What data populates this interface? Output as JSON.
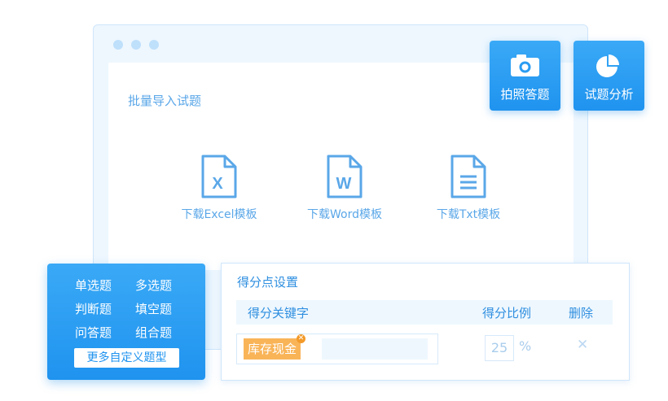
{
  "import_panel": {
    "title": "批量导入试题",
    "templates": [
      {
        "letter": "X",
        "label": "下载Excel模板"
      },
      {
        "letter": "W",
        "label": "下载Word模板"
      },
      {
        "letter": "",
        "label": "下载Txt模板"
      }
    ]
  },
  "actions": {
    "photo_answer": "拍照答题",
    "analysis": "试题分析"
  },
  "question_types": {
    "items": [
      "单选题",
      "多选题",
      "判断题",
      "填空题",
      "问答题",
      "组合题"
    ],
    "more_button": "更多自定义题型"
  },
  "score_settings": {
    "title": "得分点设置",
    "headers": {
      "keyword": "得分关键字",
      "ratio": "得分比例",
      "delete": "删除"
    },
    "keyword_tag": "库存现金",
    "ratio_value": "25",
    "percent": "%"
  },
  "colors": {
    "accent": "#1f93ef",
    "tag": "#f9b458"
  }
}
